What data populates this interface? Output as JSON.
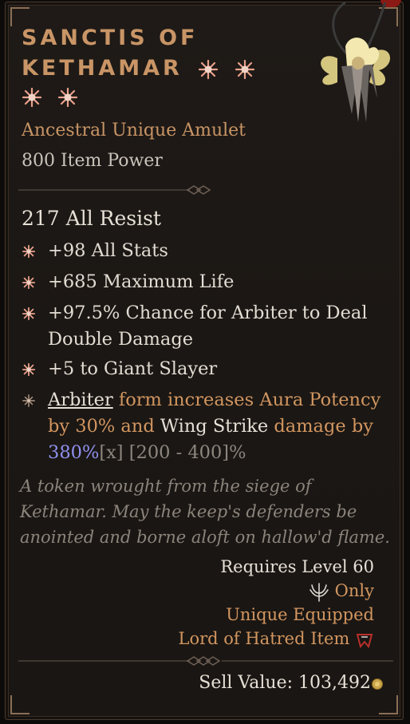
{
  "item": {
    "name_line1": "Sanctis of",
    "name_line2": "Kethamar",
    "type": "Ancestral Unique Amulet",
    "item_power": "800 Item Power",
    "main_stat": "217 All Resist",
    "affixes": [
      "+98 All Stats",
      "+685 Maximum Life",
      "+97.5% Chance for Arbiter to Deal Double Damage",
      "+5 to Giant Slayer"
    ],
    "unique_power": {
      "p1": "Arbiter",
      "p2": " form increases Aura Potency by 30% and ",
      "p3": "Wing Strike",
      "p4": " damage by ",
      "p5": "380%",
      "p6": "[x]",
      "p7": " [200 - 400]%"
    },
    "flavor": "A token wrought from the siege of Kethamar. May the keep's defenders be anointed and borne aloft on hallow'd flame.",
    "requirements": {
      "level": "Requires Level 60",
      "class_only": "Only",
      "unique_equipped": "Unique Equipped",
      "expansion": "Lord of Hatred Item"
    },
    "sell_value": "Sell Value: 103,492"
  },
  "icons": {
    "greater_affix": "greater-affix-star-icon",
    "unique_affix": "unique-affix-icon",
    "class": "paladin-class-icon",
    "expansion": "lord-of-hatred-icon",
    "gold": "gold-coin-icon",
    "item": "amulet-icon"
  },
  "colors": {
    "title": "#c99566",
    "affix_bullet": "#e8a08a",
    "unique_text": "#d29660",
    "highlight_value": "#8f90ee",
    "flavor": "#8b847b"
  }
}
